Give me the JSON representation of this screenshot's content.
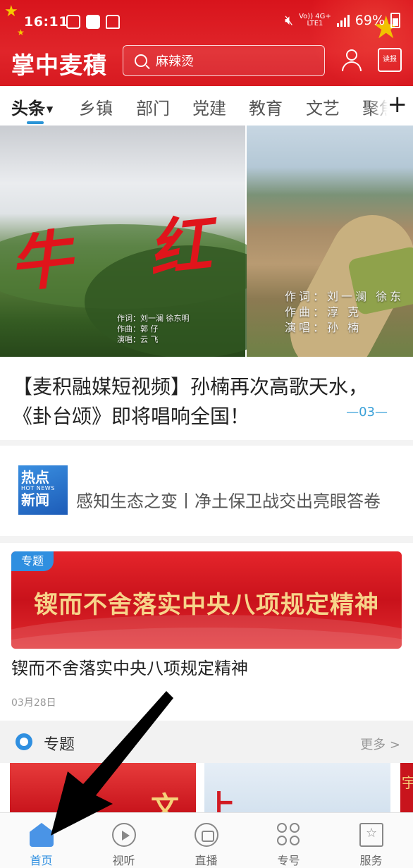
{
  "status": {
    "time": "16:11",
    "network_top": "Vo)) 4G+",
    "network_bottom": "LTE1",
    "battery": "69%"
  },
  "app": {
    "title": "掌中麦積",
    "search_placeholder": "麻辣烫",
    "read_label": "读报"
  },
  "tabs": [
    {
      "label": "头条",
      "active": true
    },
    {
      "label": "乡镇"
    },
    {
      "label": "部门"
    },
    {
      "label": "党建"
    },
    {
      "label": "教育"
    },
    {
      "label": "文艺"
    },
    {
      "label": "聚焦"
    }
  ],
  "carousel": {
    "slide1_caption": "牛 红",
    "slide1_credits": [
      "作词：刘一澜  徐东明",
      "作曲：郭  仔",
      "演唱：云  飞"
    ],
    "slide2_credits": [
      "作词：刘一澜 徐东",
      "作曲：淳  克",
      "演唱：孙  楠"
    ],
    "headline": "【麦积融媒短视频】孙楠再次高歌天水，《卦台颂》即将唱响全国！",
    "pager": "—03—"
  },
  "hot_news": {
    "logo_top": "热点",
    "logo_mid": "HOT NEWS",
    "logo_bottom": "新闻",
    "text": "感知生态之变丨净土保卫战交出亮眼答卷"
  },
  "topic_card": {
    "badge": "专题",
    "banner_text": "锲而不舍落实中央八项规定精神",
    "title": "锲而不舍落实中央八项规定精神",
    "date": "03月28日"
  },
  "section": {
    "title": "专题",
    "more": "更多 >"
  },
  "thumbs": {
    "t1": "文",
    "t2": "上",
    "t3": "宇"
  },
  "bottom_nav": [
    {
      "label": "首页",
      "icon": "home-icon",
      "active": true
    },
    {
      "label": "视听",
      "icon": "play-icon"
    },
    {
      "label": "直播",
      "icon": "live-icon"
    },
    {
      "label": "专号",
      "icon": "grid-icon"
    },
    {
      "label": "服务",
      "icon": "star-icon"
    }
  ],
  "colors": {
    "brand_red": "#d8141c",
    "accent_blue": "#2f8fe0",
    "tab_indicator": "#2a94d6"
  }
}
